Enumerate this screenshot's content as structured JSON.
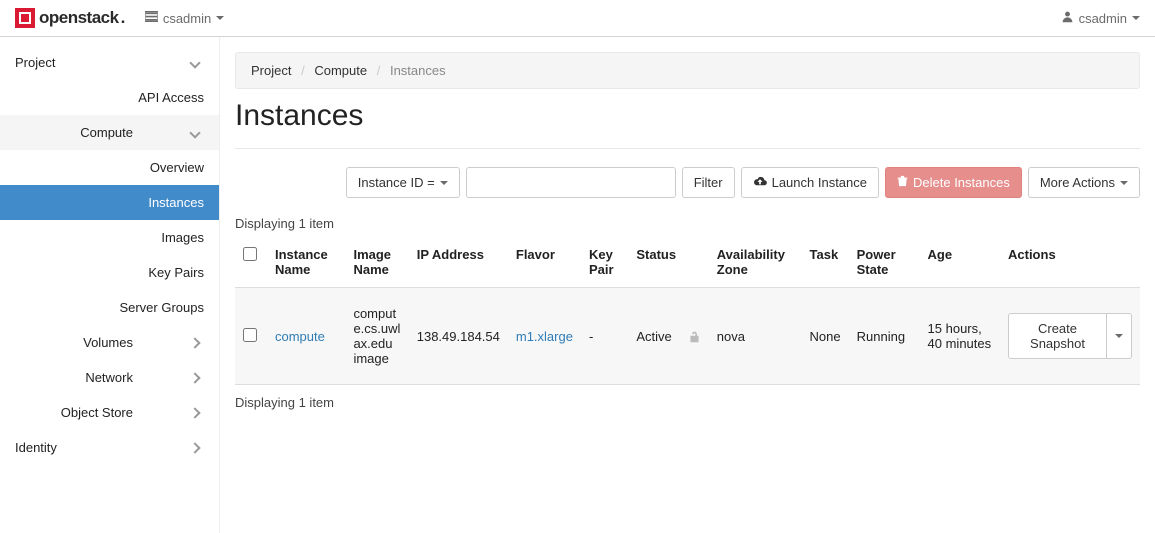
{
  "brand": "openstack",
  "topbar": {
    "project": "csadmin",
    "user": "csadmin"
  },
  "sidebar": {
    "project": "Project",
    "api_access": "API Access",
    "compute": "Compute",
    "compute_children": {
      "overview": "Overview",
      "instances": "Instances",
      "images": "Images",
      "key_pairs": "Key Pairs",
      "server_groups": "Server Groups"
    },
    "volumes": "Volumes",
    "network": "Network",
    "object_store": "Object Store",
    "identity": "Identity"
  },
  "breadcrumb": {
    "project": "Project",
    "compute": "Compute",
    "instances": "Instances"
  },
  "page_title": "Instances",
  "toolbar": {
    "filter_type": "Instance ID =",
    "filter": "Filter",
    "launch": "Launch Instance",
    "delete": "Delete Instances",
    "more": "More Actions"
  },
  "summary_top": "Displaying 1 item",
  "summary_bottom": "Displaying 1 item",
  "columns": {
    "instance_name": "Instance Name",
    "image_name": "Image Name",
    "ip": "IP Address",
    "flavor": "Flavor",
    "key_pair": "Key Pair",
    "status": "Status",
    "az": "Availability Zone",
    "task": "Task",
    "power": "Power State",
    "age": "Age",
    "actions": "Actions"
  },
  "rows": [
    {
      "name": "compute",
      "image": "compute.cs.uwlax.edu image",
      "ip": "138.49.184.54",
      "flavor": "m1.xlarge",
      "key_pair": "-",
      "status": "Active",
      "az": "nova",
      "task": "None",
      "power": "Running",
      "age": "15 hours, 40 minutes",
      "action": "Create Snapshot"
    }
  ]
}
